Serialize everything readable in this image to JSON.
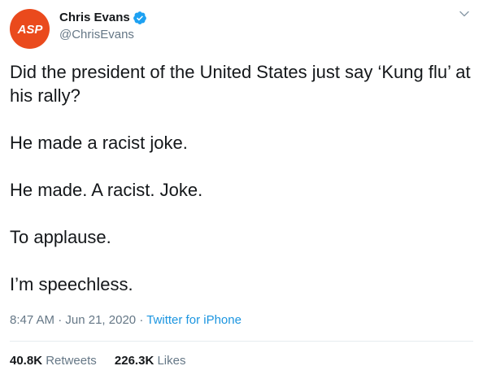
{
  "author": {
    "avatar_text": "ASP",
    "display_name": "Chris Evans",
    "handle": "@ChrisEvans",
    "verified": true
  },
  "tweet": {
    "lines": [
      "Did the president of the United States just say ‘Kung flu’ at his rally?",
      "He made a racist joke.",
      "He made. A racist. Joke.",
      "To applause.",
      "I’m speechless."
    ],
    "time": "8:47 AM",
    "date": "Jun 21, 2020",
    "separator": "·",
    "source": "Twitter for iPhone"
  },
  "stats": {
    "retweets_count": "40.8K",
    "retweets_label": "Retweets",
    "likes_count": "226.3K",
    "likes_label": "Likes"
  },
  "colors": {
    "avatar_bg": "#ea4a1d",
    "verified_blue": "#1da1f2",
    "link_blue": "#1b95e0",
    "secondary_text": "#657786"
  },
  "icons": {
    "verified": "verified-badge-icon",
    "caret": "chevron-down-icon"
  }
}
